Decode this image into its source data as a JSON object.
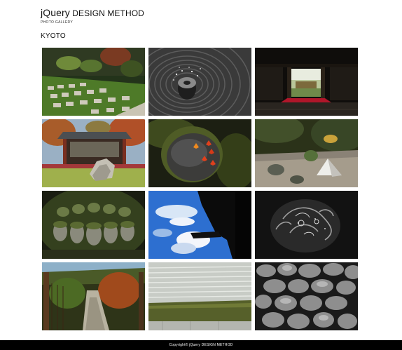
{
  "site": {
    "brand_a": "jQuery",
    "brand_b": "DESIGN METHOD",
    "subtitle": "PHOTO GALLERY"
  },
  "gallery": {
    "section_title": "KYOTO",
    "photos": [
      "moss-garden-stepping-stones",
      "raked-gravel-stone-basin",
      "dark-temple-hall-view",
      "temple-gate-autumn-rocks",
      "maple-leaves-on-mossy-stone",
      "dry-garden-sand-cone",
      "moss-covered-stone-buddhas",
      "blue-sky-temple-roof-silhouette",
      "dragon-ceiling-painting",
      "mossy-stone-path-bamboo-fence",
      "raked-sand-moss-strip",
      "stone-wall-close-up"
    ]
  },
  "footer": {
    "copyright": "Copyright© jQuery DESIGN METHOD"
  }
}
